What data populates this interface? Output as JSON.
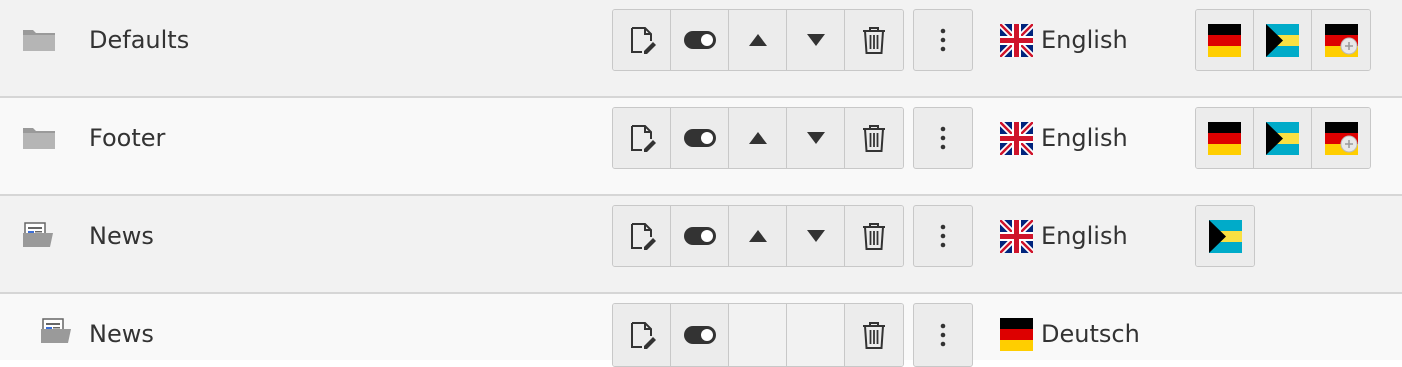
{
  "rows": [
    {
      "title": "Defaults",
      "icon": "folder-icon",
      "language": "English",
      "language_flag": "uk-flag-icon",
      "has_move_buttons": true,
      "translations": [
        "de-flag-icon",
        "bs-flag-icon",
        "de-flag-badge-icon"
      ]
    },
    {
      "title": "Footer",
      "icon": "folder-icon",
      "language": "English",
      "language_flag": "uk-flag-icon",
      "has_move_buttons": true,
      "translations": [
        "de-flag-icon",
        "bs-flag-icon",
        "de-flag-badge-icon"
      ]
    },
    {
      "title": "News",
      "icon": "news-folder-icon",
      "language": "English",
      "language_flag": "uk-flag-icon",
      "has_move_buttons": true,
      "translations": [
        "bs-flag-icon"
      ]
    },
    {
      "title": "News",
      "icon": "news-folder-icon",
      "language": "Deutsch",
      "language_flag": "de-flag-icon",
      "has_move_buttons": false,
      "translations": []
    }
  ],
  "action_icons": [
    "edit-icon",
    "toggle-icon",
    "move-up-icon",
    "move-down-icon",
    "delete-icon",
    "more-icon"
  ],
  "colors": {
    "row_odd": "#f2f2f2",
    "row_even": "#f9f9f9",
    "button_bg": "#ececec",
    "border": "#c8c8c8",
    "icon": "#333333"
  }
}
